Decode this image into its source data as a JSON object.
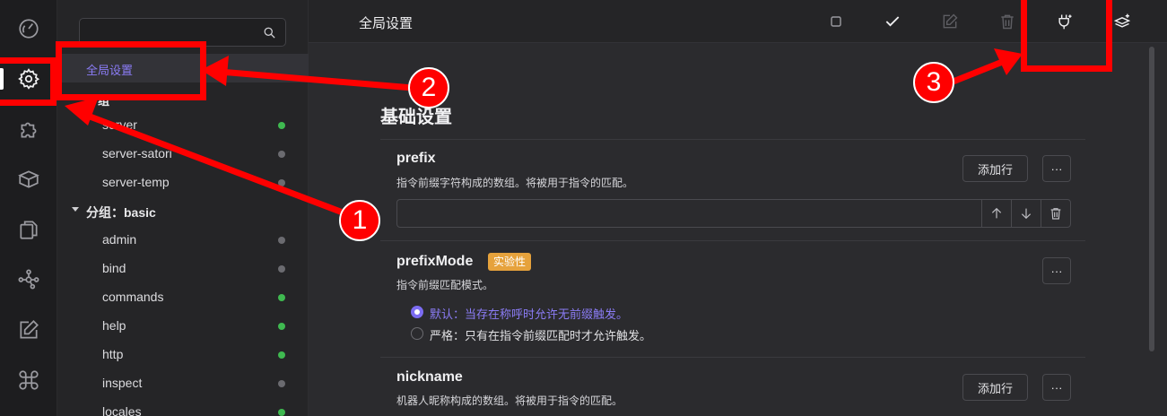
{
  "activity_bar": {
    "items": [
      {
        "name": "dashboard-icon"
      },
      {
        "name": "settings-gear-icon",
        "active": true
      },
      {
        "name": "puzzle-plugins-icon"
      },
      {
        "name": "package-box-icon"
      },
      {
        "name": "files-copy-icon"
      },
      {
        "name": "network-graph-icon"
      },
      {
        "name": "edit-pen-icon"
      },
      {
        "name": "command-icon"
      }
    ]
  },
  "sidebar": {
    "search_placeholder": "",
    "selected": "全局设置",
    "partial_group": "分组",
    "items": [
      {
        "label": "server",
        "enabled": true
      },
      {
        "label": "server-satori",
        "enabled": false
      },
      {
        "label": "server-temp",
        "enabled": false
      }
    ],
    "group_basic": "分组：basic",
    "basic_items": [
      {
        "label": "admin",
        "enabled": false
      },
      {
        "label": "bind",
        "enabled": false
      },
      {
        "label": "commands",
        "enabled": true
      },
      {
        "label": "help",
        "enabled": true
      },
      {
        "label": "http",
        "enabled": true
      },
      {
        "label": "inspect",
        "enabled": false
      },
      {
        "label": "locales",
        "enabled": true
      }
    ]
  },
  "header": {
    "title": "全局设置",
    "buttons": [
      "checkbox-icon",
      "check-icon",
      "edit-icon",
      "trash-icon",
      "plug-add-icon",
      "layers-add-icon"
    ]
  },
  "content": {
    "section_title": "基础设置",
    "prefix": {
      "name": "prefix",
      "desc": "指令前缀字符构成的数组。将被用于指令的匹配。",
      "add_label": "添加行",
      "more_label": "···"
    },
    "prefixMode": {
      "name": "prefixMode",
      "badge": "实验性",
      "desc": "指令前缀匹配模式。",
      "more_label": "···",
      "options": [
        {
          "label": "默认：当存在称呼时允许无前缀触发。",
          "selected": true
        },
        {
          "label": "严格：只有在指令前缀匹配时才允许触发。",
          "selected": false
        }
      ]
    },
    "nickname": {
      "name": "nickname",
      "desc": "机器人昵称构成的数组。将被用于指令的匹配。",
      "add_label": "添加行",
      "more_label": "···"
    }
  },
  "annotations": {
    "callouts": [
      "1",
      "2",
      "3"
    ],
    "color": "#ff0000"
  },
  "colors": {
    "accent": "#7c6cf2",
    "status_on": "#3fb950",
    "status_off": "#6b6b70",
    "badge": "#e6a23c"
  }
}
